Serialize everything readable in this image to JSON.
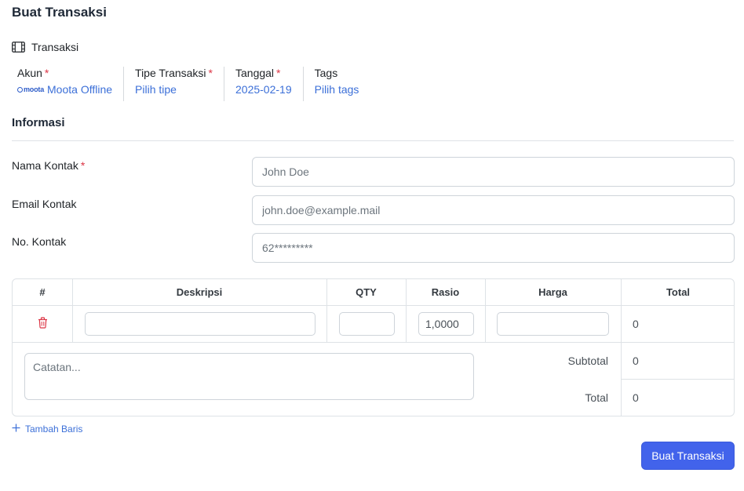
{
  "page": {
    "title": "Buat Transaksi"
  },
  "section": {
    "label": "Transaksi",
    "icon": "film-icon"
  },
  "meta": {
    "account": {
      "label": "Akun",
      "required": "*",
      "logo_text": "moota",
      "value": "Moota Offline"
    },
    "type": {
      "label": "Tipe Transaksi",
      "required": "*",
      "value": "Pilih tipe"
    },
    "date": {
      "label": "Tanggal",
      "required": "*",
      "value": "2025-02-19"
    },
    "tags": {
      "label": "Tags",
      "value": "Pilih tags"
    }
  },
  "info": {
    "title": "Informasi",
    "fields": {
      "name": {
        "label": "Nama Kontak",
        "required": "*",
        "placeholder": "John Doe"
      },
      "email": {
        "label": "Email Kontak",
        "placeholder": "john.doe@example.mail"
      },
      "phone": {
        "label": "No. Kontak",
        "placeholder": "62*********"
      }
    }
  },
  "table": {
    "headers": [
      "#",
      "Deskripsi",
      "QTY",
      "Rasio",
      "Harga",
      "Total"
    ],
    "row": {
      "description": "",
      "qty": "",
      "ratio": "1,0000",
      "price": "",
      "total": "0"
    },
    "notes_placeholder": "Catatan...",
    "subtotal_label": "Subtotal",
    "subtotal_value": "0",
    "total_label": "Total",
    "total_value": "0"
  },
  "actions": {
    "add_row": "Tambah Baris",
    "submit": "Buat Transaksi"
  },
  "colors": {
    "accent": "#4263eb",
    "link": "#3b6fd8",
    "required": "#dc3545",
    "delete": "#dc3545"
  }
}
